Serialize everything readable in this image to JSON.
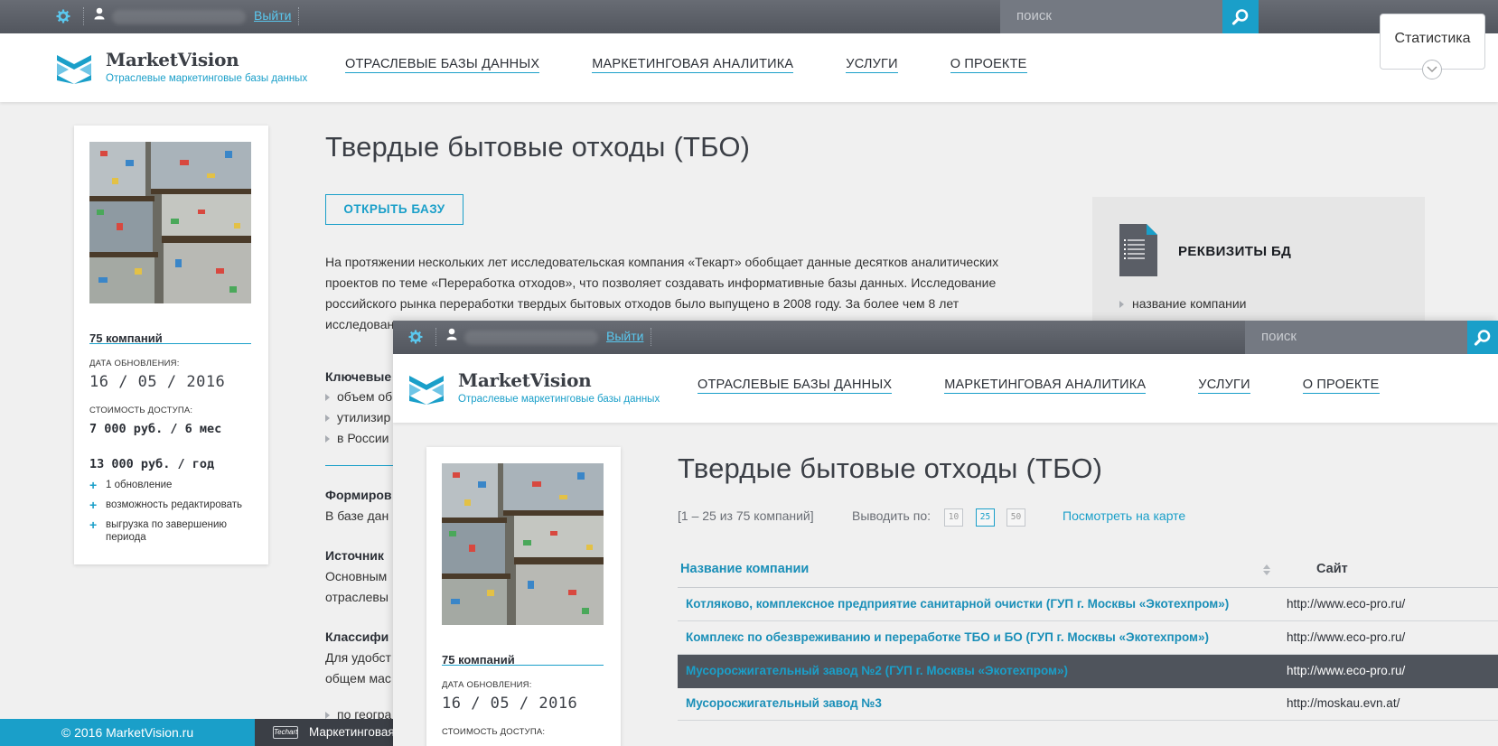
{
  "topbar": {
    "logout_label": "Выйти",
    "search_placeholder": "поиск"
  },
  "logo": {
    "name": "MarketVision",
    "tagline": "Отраслевые маркетинговые базы данных"
  },
  "nav": {
    "items": [
      {
        "label": "ОТРАСЛЕВЫЕ БАЗЫ ДАННЫХ"
      },
      {
        "label": "МАРКЕТИНГОВАЯ АНАЛИТИКА"
      },
      {
        "label": "УСЛУГИ"
      },
      {
        "label": "О ПРОЕКТЕ"
      }
    ]
  },
  "stat_tab": {
    "label": "Статистика"
  },
  "card": {
    "companies": "75 компаний",
    "update_label": "ДАТА ОБНОВЛЕНИЯ:",
    "update_date": "16 / 05 / 2016",
    "cost_label": "СТОИМОСТЬ ДОСТУПА:",
    "price_month": "7 000 руб. / 6 мес",
    "price_year": "13 000 руб. / год",
    "features": [
      "1 обновление",
      "возможность редактировать",
      "выгрузка по завершению периода"
    ]
  },
  "page": {
    "title": "Твердые бытовые отходы (ТБО)",
    "open_button": "ОТКРЫТЬ БАЗУ",
    "description_lines": [
      "На протяжении нескольких лет исследовательская компания «Текарт» обобщает данные десятков аналитических",
      "проектов по теме «Переработка отходов», что позволяет создавать информативные базы данных. Исследование",
      "российского рынка переработки твердых бытовых отходов было выпущено в 2008 году. За более чем 8 лет",
      "исследован"
    ],
    "key_heading": "Ключевые",
    "key_bullets": [
      "объем об",
      "утилизир",
      "в России"
    ],
    "form_heading": "Формиров",
    "form_text": "В базе дан",
    "sources_heading": "Источник",
    "sources_lines": [
      "Основным",
      "отраслевы"
    ],
    "class_heading": "Классифи",
    "class_lines": [
      "Для удобст",
      "общем мас"
    ],
    "geo_bullet": "по геогра"
  },
  "requisites": {
    "title": "РЕКВИЗИТЫ БД",
    "item": "название компании"
  },
  "footer": {
    "copyright": "© 2016 MarketVision.ru",
    "techart": "Techart",
    "text": "Маркетинговая"
  },
  "list": {
    "range": "[1 – 25 из 75 компаний]",
    "per_page_label": "Выводить по:",
    "per_page_options": [
      "10",
      "25",
      "50"
    ],
    "per_page_active": "25",
    "map_link": "Посмотреть на карте",
    "col_name": "Название компании",
    "col_site": "Сайт",
    "rows": [
      {
        "name": "Котляково, комплексное предприятие санитарной очистки (ГУП г. Москвы «Экотехпром»)",
        "site": "http://www.eco-pro.ru/"
      },
      {
        "name": "Комплекс по обезвреживанию и переработке ТБО и БО (ГУП г. Москвы «Экотехпром»)",
        "site": "http://www.eco-pro.ru/"
      },
      {
        "name": "Мусоросжигательный завод №2 (ГУП г. Москвы «Экотехпром»)",
        "site": "http://www.eco-pro.ru/"
      },
      {
        "name": "Мусоросжигательный завод №3",
        "site": "http://moskau.evn.at/"
      }
    ]
  },
  "colors": {
    "accent": "#1a9fc9",
    "topbar": "#5a5e66",
    "highlight_row": "#4f545c"
  }
}
